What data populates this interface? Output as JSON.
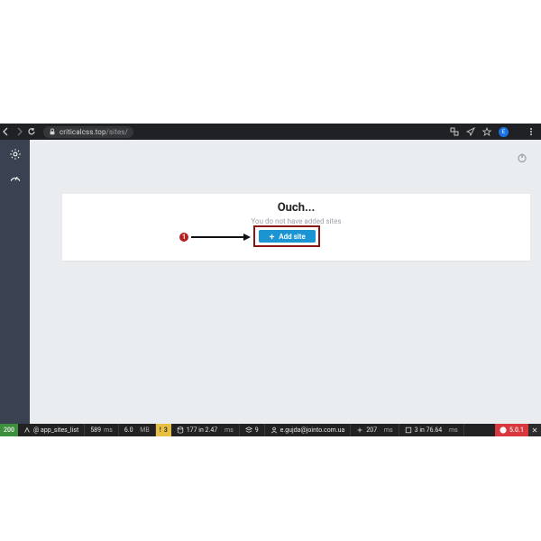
{
  "browser": {
    "url_host": "criticalcss.top",
    "url_path": "/sites/",
    "avatar_initial": "E"
  },
  "annotation": {
    "number": "1"
  },
  "page": {
    "title": "Ouch...",
    "subtitle": "You do not have added sites",
    "add_button": "Add site"
  },
  "debug": {
    "status": "200",
    "route": "@ app_sites_list",
    "time": {
      "value": "589",
      "unit": "ms"
    },
    "mem": {
      "value": "6.0",
      "unit": "MB"
    },
    "warn": "3",
    "db": {
      "value": "177 in 2.47",
      "unit": "ms"
    },
    "cache": "9",
    "user": "e.gujda@jointo.com.ua",
    "extra1": {
      "value": "207",
      "unit": "ms"
    },
    "extra2": {
      "value": "3 in 76.64",
      "unit": "ms"
    },
    "version": "5.0.1"
  }
}
